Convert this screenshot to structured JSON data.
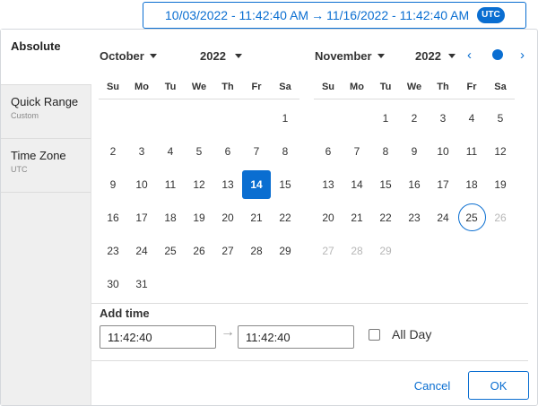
{
  "range": {
    "start": "10/03/2022 - 11:42:40 AM",
    "arrow": "→",
    "end": "11/16/2022 - 11:42:40 AM",
    "tz_badge": "UTC"
  },
  "sidebar": {
    "items": [
      {
        "label": "Absolute",
        "sub": ""
      },
      {
        "label": "Quick Range",
        "sub": "Custom"
      },
      {
        "label": "Time Zone",
        "sub": "UTC"
      }
    ]
  },
  "weekdays": [
    "Su",
    "Mo",
    "Tu",
    "We",
    "Th",
    "Fr",
    "Sa"
  ],
  "left_cal": {
    "month": "October",
    "year": "2022",
    "lead_blanks": 6,
    "days": 31,
    "selected": 14,
    "today": null,
    "disabled_from": 99,
    "blocked": null
  },
  "right_cal": {
    "month": "November",
    "year": "2022",
    "lead_blanks": 2,
    "days": 29,
    "selected": null,
    "today": 25,
    "disabled_from": 26,
    "blocked": 30
  },
  "nav": {
    "prev": "‹",
    "next": "›"
  },
  "time": {
    "label": "Add time",
    "start_value": "11:42:40",
    "end_value": "11:42:40",
    "arrow": "→",
    "all_day_label": "All Day"
  },
  "actions": {
    "cancel": "Cancel",
    "ok": "OK"
  },
  "colors": {
    "accent": "#0a6ed1",
    "blocked": "#d0021b"
  }
}
